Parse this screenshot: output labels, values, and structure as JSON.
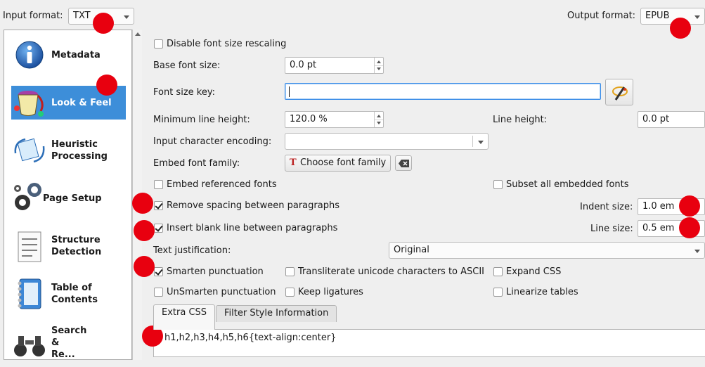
{
  "header": {
    "input_format_label": "Input format:",
    "input_format_value": "TXT",
    "output_format_label": "Output format:",
    "output_format_value": "EPUB"
  },
  "sidebar": {
    "items": [
      {
        "label": "Metadata",
        "icon": "info-icon"
      },
      {
        "label": "Look & Feel",
        "icon": "paint-bucket-icon",
        "selected": true
      },
      {
        "label": "Heuristic Processing",
        "line1": "Heuristic",
        "line2": "Processing",
        "icon": "heuristic-icon"
      },
      {
        "label": "Page Setup",
        "icon": "gears-icon"
      },
      {
        "label": "Structure Detection",
        "line1": "Structure",
        "line2": "Detection",
        "icon": "document-icon"
      },
      {
        "label": "Table of Contents",
        "line1": "Table of",
        "line2": "Contents",
        "icon": "notebook-icon"
      },
      {
        "label": "Search & Replace",
        "line1": "Search",
        "line2": "&",
        "line3": "Re...",
        "icon": "binoculars-icon"
      }
    ]
  },
  "options": {
    "disable_font_rescaling": {
      "label": "Disable font size rescaling",
      "checked": false
    },
    "base_font_size": {
      "label": "Base font size:",
      "value": "0.0 pt"
    },
    "font_size_key": {
      "label": "Font size key:",
      "value": ""
    },
    "min_line_height": {
      "label": "Minimum line height:",
      "value": "120.0 %"
    },
    "line_height": {
      "label": "Line height:",
      "value": "0.0 pt"
    },
    "input_encoding": {
      "label": "Input character encoding:",
      "value": ""
    },
    "embed_font_family": {
      "label": "Embed font family:",
      "button": "Choose font family"
    },
    "embed_referenced_fonts": {
      "label": "Embed referenced fonts",
      "checked": false
    },
    "subset_embedded_fonts": {
      "label": "Subset all embedded fonts",
      "checked": false
    },
    "remove_spacing": {
      "label": "Remove spacing between paragraphs",
      "checked": true
    },
    "indent_size": {
      "label": "Indent size:",
      "value": "1.0 em"
    },
    "insert_blank_line": {
      "label": "Insert blank line between paragraphs",
      "checked": true
    },
    "line_size": {
      "label": "Line size:",
      "value": "0.5 em"
    },
    "text_justification": {
      "label": "Text justification:",
      "value": "Original"
    },
    "smarten_punctuation": {
      "label": "Smarten punctuation",
      "checked": true
    },
    "transliterate": {
      "label": "Transliterate unicode characters to ASCII",
      "checked": false
    },
    "expand_css": {
      "label": "Expand CSS",
      "checked": false
    },
    "unsmarten_punctuation": {
      "label": "UnSmarten punctuation",
      "checked": false
    },
    "keep_ligatures": {
      "label": "Keep ligatures",
      "checked": false
    },
    "linearize_tables": {
      "label": "Linearize tables",
      "checked": false
    }
  },
  "tabs": [
    {
      "label": "Extra CSS",
      "active": true
    },
    {
      "label": "Filter Style Information",
      "active": false
    }
  ],
  "extra_css": "h1,h2,h3,h4,h5,h6{text-align:center}",
  "colors": {
    "selection": "#3d8ed9",
    "marker": "#e8000f",
    "focus": "#3d8ee8"
  }
}
